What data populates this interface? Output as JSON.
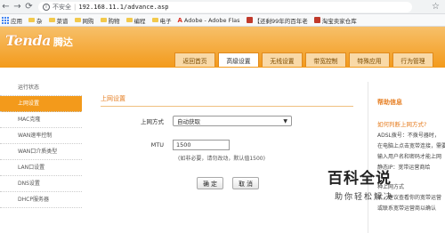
{
  "browser": {
    "insecure_label": "不安全",
    "separator": "|",
    "url": "192.168.11.1/advance.asp",
    "bookmarks": [
      {
        "label": "应用",
        "icon": "apps-grid-icon"
      },
      {
        "label": "杂",
        "icon": "folder-icon"
      },
      {
        "label": "菜谱",
        "icon": "folder-icon"
      },
      {
        "label": "网购",
        "icon": "folder-icon"
      },
      {
        "label": "购物",
        "icon": "folder-icon"
      },
      {
        "label": "编程",
        "icon": "folder-icon"
      },
      {
        "label": "电子",
        "icon": "folder-icon"
      },
      {
        "label": "Adobe - Adobe Flas",
        "icon": "adobe-icon"
      },
      {
        "label": "【还剩99年的百年老",
        "icon": "favicon-red"
      },
      {
        "label": "淘宝卖家仓库",
        "icon": "favicon-red"
      }
    ]
  },
  "router": {
    "brand": "Tenda",
    "brand_cn": "腾达",
    "tabs": [
      "返回首页",
      "高级设置",
      "无线设置",
      "带宽控制",
      "特殊应用",
      "行为管理"
    ],
    "active_tab_index": 1
  },
  "sidebar": {
    "items": [
      "运行状态",
      "上网设置",
      "MAC克隆",
      "WAN速率控制",
      "WAN口介质类型",
      "LAN口设置",
      "DNS设置",
      "DHCP服务器"
    ],
    "active_index": 1
  },
  "form": {
    "section_title": "上网设置",
    "mode_label": "上网方式",
    "mode_value": "自动获取",
    "mtu_label": "MTU",
    "mtu_value": "1500",
    "mtu_hint": "(如非必要，请勿改动，默认值1500)",
    "ok_label": "确 定",
    "cancel_label": "取 消"
  },
  "help": {
    "title": "帮助信息",
    "question": "如何判断上网方式?",
    "lines": [
      "ADSL拨号：不拨号器时，",
      "在电脑上点击宽带连接，需要",
      "输入用户名和密码才能上网",
      "静态IP：宽带运营商给",
      "……",
      "种上网方式",
      "式，建议查看你的宽带运营",
      "或联系宽带运营商以确认"
    ]
  },
  "watermark": {
    "big": "百科全说",
    "small": "助你轻松解决"
  },
  "colors": {
    "accent": "#f39a1b",
    "help_accent": "#e67e22"
  }
}
